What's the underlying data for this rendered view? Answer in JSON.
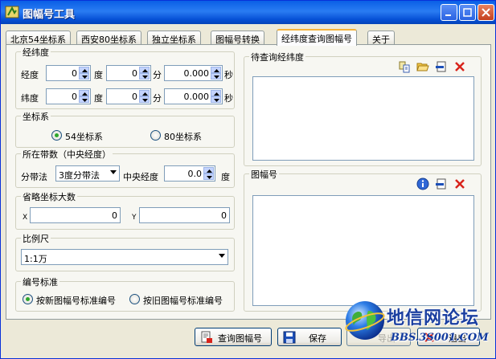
{
  "window": {
    "title": "图幅号工具"
  },
  "tabs": [
    {
      "label": "北京54坐标系"
    },
    {
      "label": "西安80坐标系"
    },
    {
      "label": "独立坐标系"
    },
    {
      "label": "图幅号转换"
    },
    {
      "label": "经纬度查询图幅号",
      "active": true
    },
    {
      "label": "关于"
    }
  ],
  "latlon_group": {
    "title": "经纬度",
    "longitude": {
      "label": "经度",
      "deg": "0",
      "min": "0",
      "sec": "0.000"
    },
    "latitude": {
      "label": "纬度",
      "deg": "0",
      "min": "0",
      "sec": "0.000"
    },
    "unit_deg": "度",
    "unit_min": "分",
    "unit_sec": "秒"
  },
  "coord_group": {
    "title": "坐标系",
    "option_54": "54坐标系",
    "option_80": "80坐标系",
    "selected": "54坐标系"
  },
  "zone_group": {
    "title": "所在带数（中央经度）",
    "method_label": "分带法",
    "method_value": "3度分带法",
    "meridian_label": "中央经度",
    "meridian_value": "0.0",
    "meridian_unit": "度"
  },
  "offset_group": {
    "title": "省略坐标大数",
    "x_label": "X",
    "x_value": "0",
    "y_label": "Y",
    "y_value": "0"
  },
  "scale_group": {
    "title": "比例尺",
    "value": "1:1万"
  },
  "code_group": {
    "title": "编号标准",
    "option_new": "按新图幅号标准编号",
    "option_old": "按旧图幅号标准编号",
    "selected": "按新图幅号标准编号"
  },
  "pending_group": {
    "title": "待查询经纬度"
  },
  "mapsheet_group": {
    "title": "图幅号"
  },
  "buttons": {
    "query": "查询图幅号",
    "save": "保存",
    "export": "导出",
    "exit": "退出"
  },
  "watermark": {
    "cn": "地信网论坛",
    "en": "BBS.3S001.COM"
  },
  "colors": {
    "title_bar": "#0a5fe6",
    "tab_highlight": "#f5b33a",
    "radio_dot": "#2ea72b"
  }
}
